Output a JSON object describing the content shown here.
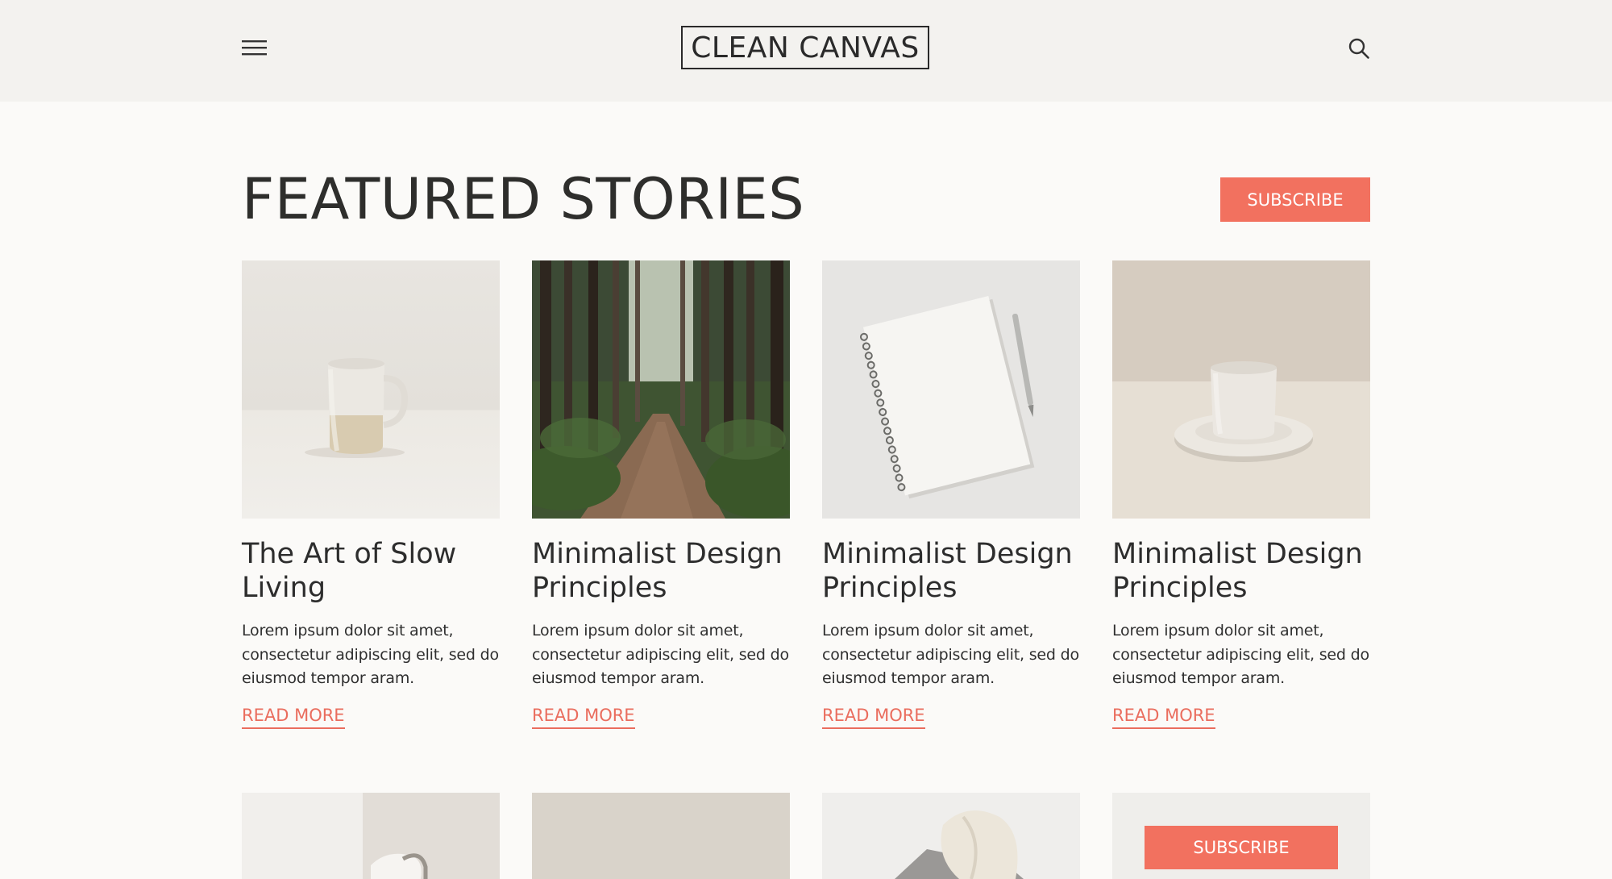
{
  "header": {
    "logo_text": "CLEAN CANVAS",
    "menu_icon": "hamburger-menu-icon",
    "search_icon": "search-icon"
  },
  "main": {
    "title": "FEATURED STORIES",
    "subscribe_label": "SUBSCRIBE",
    "accent_color": "#f2715f",
    "stories": [
      {
        "title": "The Art of Slow Living",
        "excerpt": "Lorem ipsum dolor sit amet, consectetur adipiscing elit, sed do eiusmod tempor aram.",
        "read_more": "READ MORE",
        "image": "ceramic-mug-photo"
      },
      {
        "title": "Minimalist Design Principles",
        "excerpt": "Lorem ipsum dolor sit amet, consectetur adipiscing elit, sed do eiusmod tempor aram.",
        "read_more": "READ MORE",
        "image": "forest-path-photo"
      },
      {
        "title": "Minimalist Design Principles",
        "excerpt": "Lorem ipsum dolor sit amet, consectetur adipiscing elit, sed do eiusmod tempor aram.",
        "read_more": "READ MORE",
        "image": "notebook-and-pen-photo"
      },
      {
        "title": "Minimalist Design Principles",
        "excerpt": "Lorem ipsum dolor sit amet, consectetur adipiscing elit, sed do eiusmod tempor aram.",
        "read_more": "READ MORE",
        "image": "cup-and-saucer-photo"
      }
    ],
    "second_row": {
      "subscribe_label": "SUBSCRIBE"
    }
  }
}
